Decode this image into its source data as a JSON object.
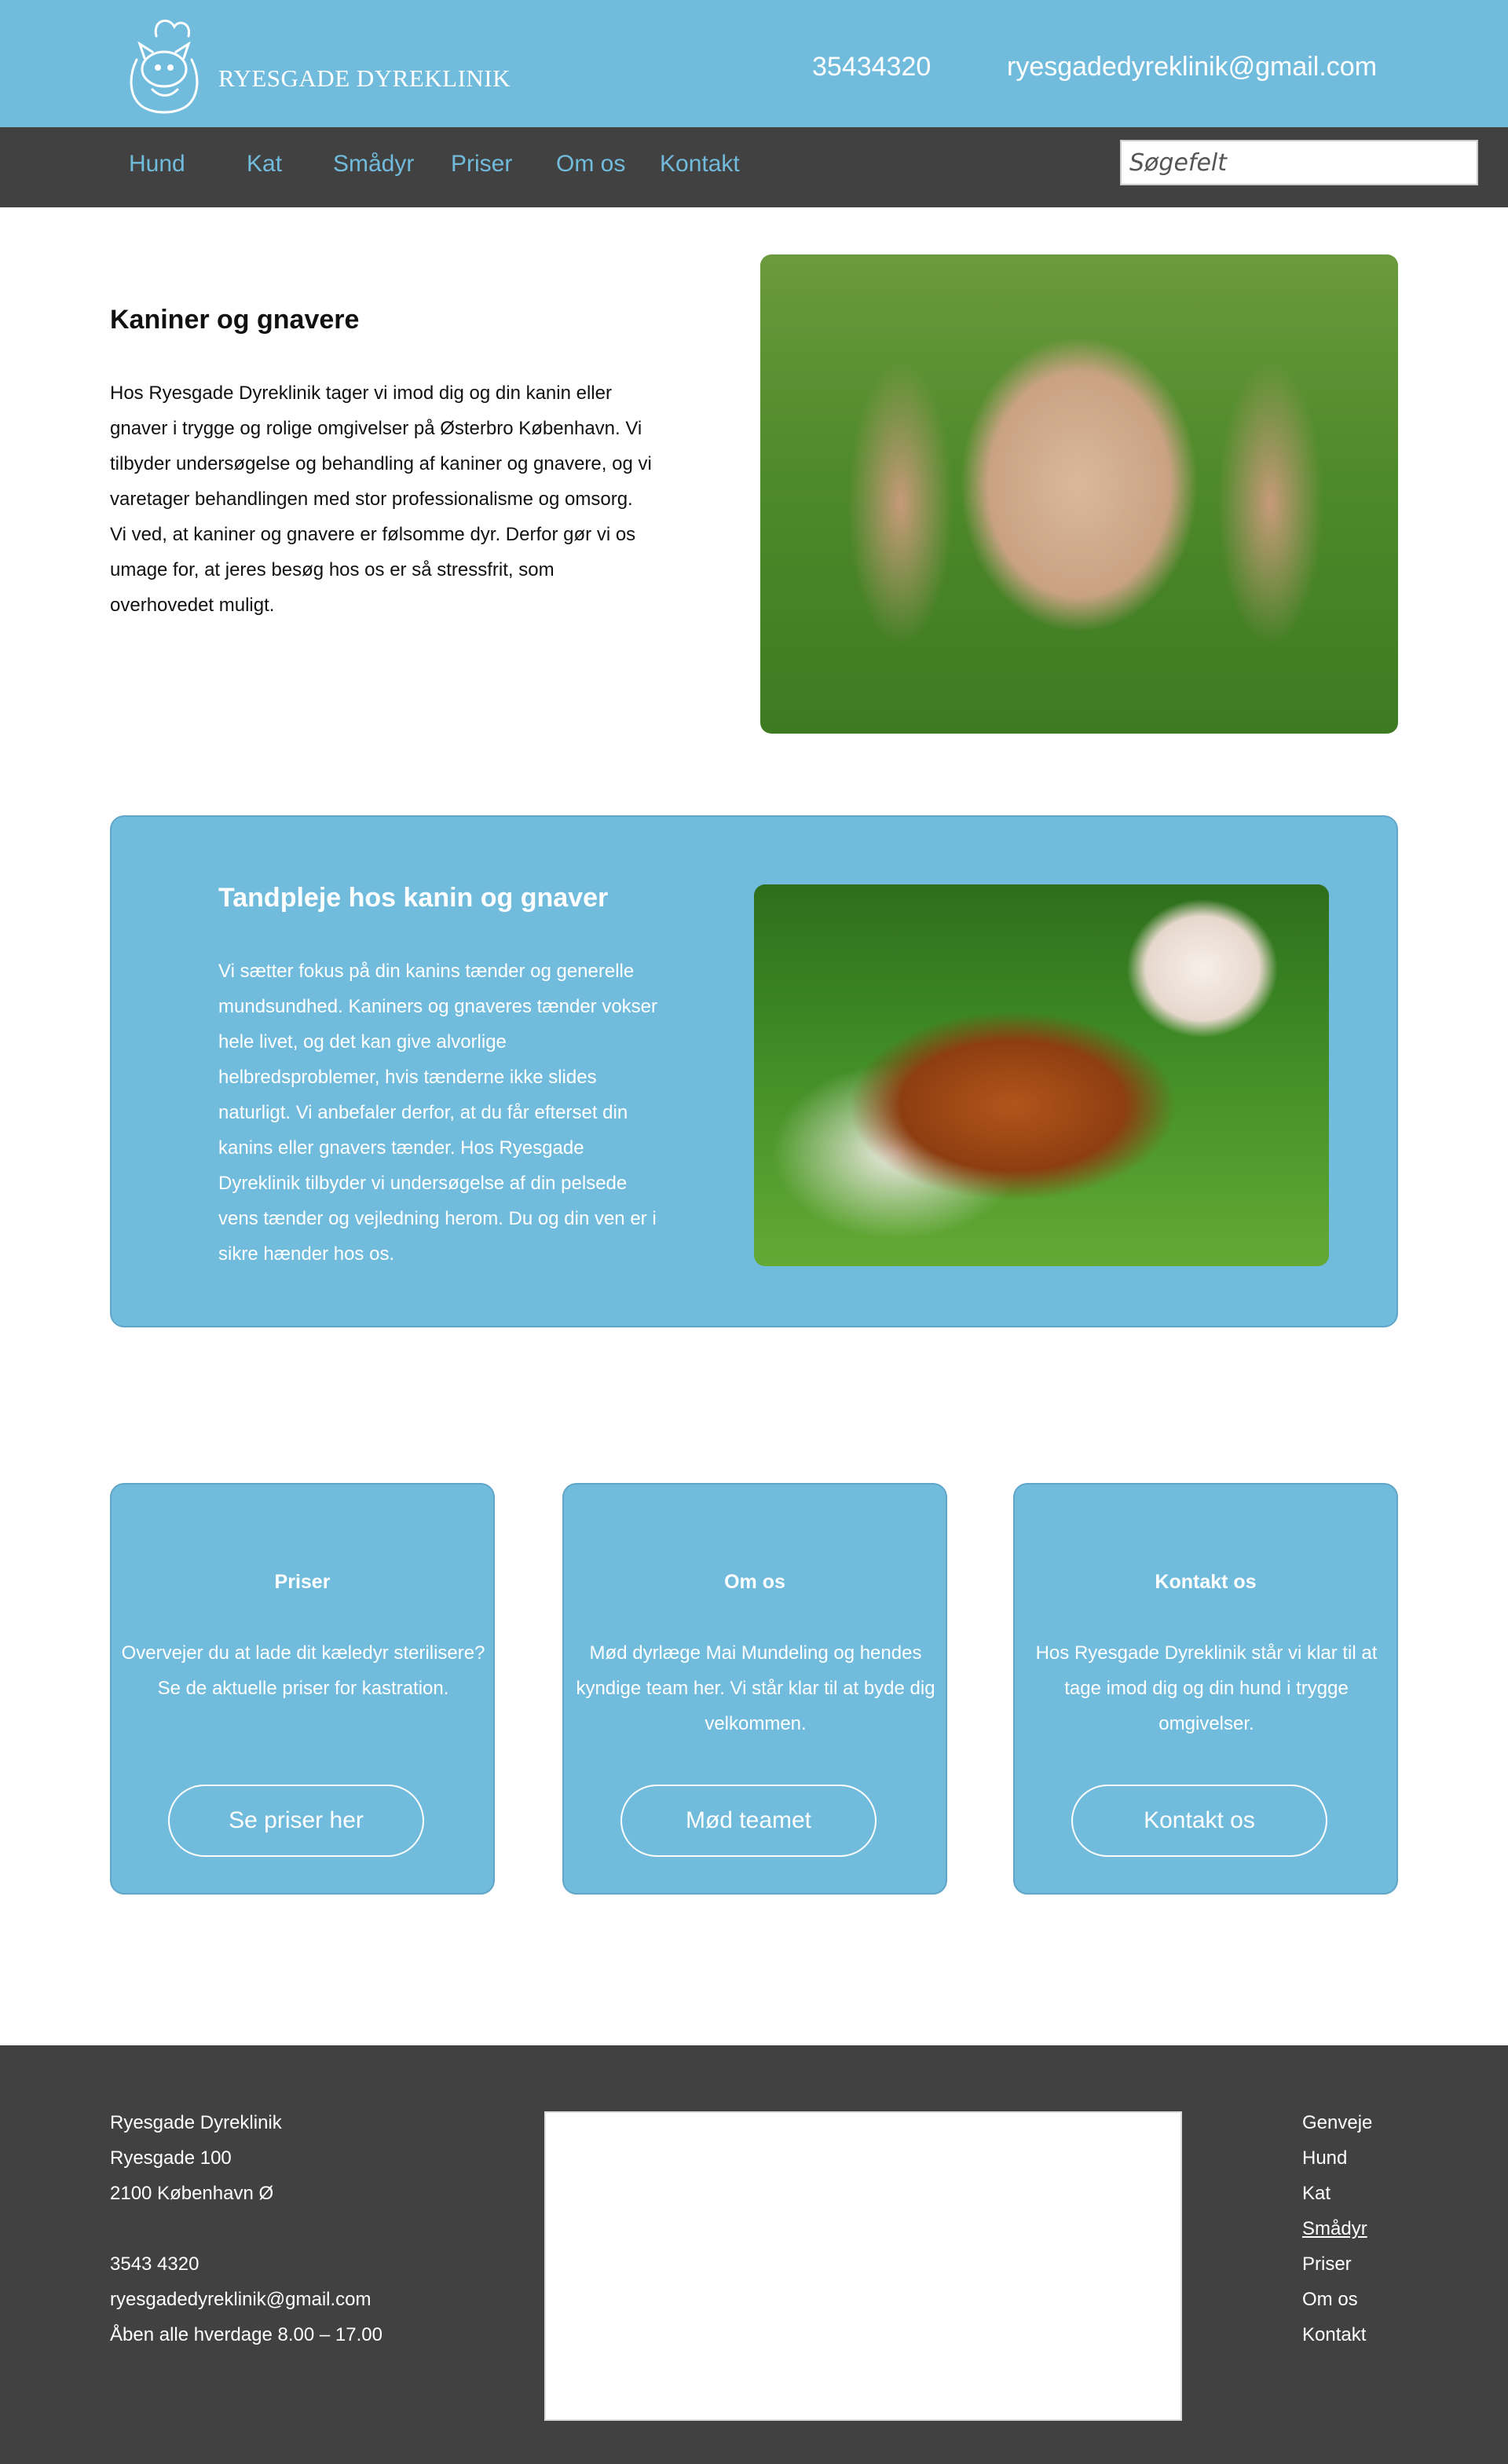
{
  "header": {
    "logo_text": "RYESGADE DYREKLINIK",
    "phone": "35434320",
    "email": "ryesgadedyreklinik@gmail.com"
  },
  "nav": {
    "items": [
      "Hund",
      "Kat",
      "Smådyr",
      "Priser",
      "Om os",
      "Kontakt"
    ],
    "search_placeholder": "Søgefelt"
  },
  "section1": {
    "title": "Kaniner og gnavere",
    "text": "Hos Ryesgade Dyreklinik tager vi imod dig og din kanin eller gnaver i trygge og rolige omgivelser på Østerbro København. Vi tilbyder undersøgelse og behandling af kaniner og gnavere, og vi varetager behandlingen med stor professionalisme og omsorg. Vi ved, at kaniner og gnavere er følsomme dyr. Derfor gør vi os umage for, at jeres besøg hos os er så stressfrit, som overhovedet muligt."
  },
  "section2": {
    "title": "Tandpleje hos kanin og gnaver",
    "text": "Vi sætter fokus på din kanins tænder og generelle mundsundhed. Kaniners og gnaveres tænder vokser hele livet, og det kan give alvorlige helbredsproblemer, hvis tænderne ikke slides naturligt. Vi anbefaler derfor, at du får efterset din kanins eller gnavers tænder. Hos Ryesgade Dyreklinik tilbyder vi undersøgelse af din pelsede vens tænder og vejledning herom. Du og din ven er i sikre hænder hos os."
  },
  "cards": [
    {
      "title": "Priser",
      "text": "Overvejer du at lade dit kæledyr sterilisere? Se de aktuelle priser for kastration.",
      "button": "Se priser her"
    },
    {
      "title": "Om os",
      "text": "Mød dyrlæge Mai Mundeling og hendes kyndige team her. Vi står klar til at byde dig velkommen.",
      "button": "Mød teamet"
    },
    {
      "title": "Kontakt os",
      "text": "Hos Ryesgade Dyreklinik står vi klar til at tage imod dig og din hund i trygge omgivelser.",
      "button": "Kontakt os"
    }
  ],
  "footer": {
    "address": [
      "Ryesgade Dyreklinik",
      "Ryesgade 100",
      "2100 København Ø"
    ],
    "contact": [
      "3543 4320",
      "ryesgadedyreklinik@gmail.com",
      "Åben alle hverdage 8.00 – 17.00"
    ],
    "links_title": "Genveje",
    "links": [
      "Hund",
      "Kat",
      "Smådyr",
      "Priser",
      "Om os",
      "Kontakt"
    ]
  }
}
